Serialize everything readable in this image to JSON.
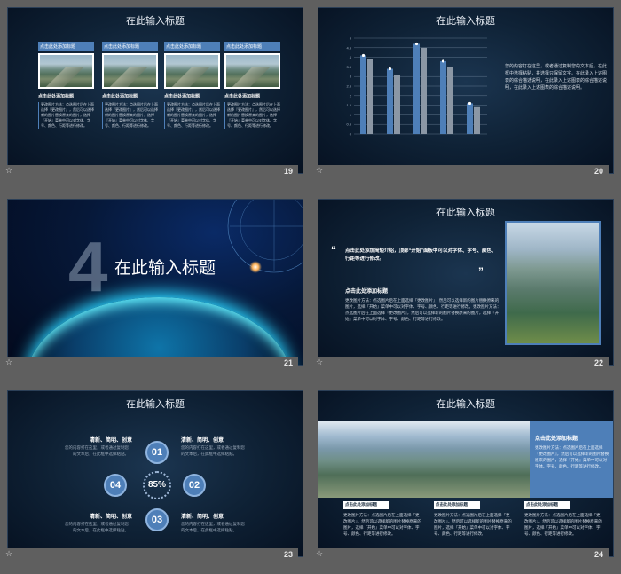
{
  "slides": [
    {
      "num": "19",
      "title": "在此输入标题",
      "cards": [
        {
          "head": "点击此处添加标题",
          "sub": "点击此处添加标题",
          "body": "更改图片方法：点选图片后在上面选择『更改图片』，然后可以选择新的图片替换原来的图片，选择『开始』菜单中可以对字体、字号、颜色、行距等进行修改。"
        },
        {
          "head": "点击此处添加标题",
          "sub": "点击此处添加标题",
          "body": "更改图片方法：点选图片后在上面选择『更改图片』，然后可以选择新的图片替换原来的图片，选择『开始』菜单中可以对字体、字号、颜色、行距等进行修改。"
        },
        {
          "head": "点击此处添加标题",
          "sub": "点击此处添加标题",
          "body": "更改图片方法：点选图片后在上面选择『更改图片』，然后可以选择新的图片替换原来的图片，选择『开始』菜单中可以对字体、字号、颜色、行距等进行修改。"
        },
        {
          "head": "点击此处添加标题",
          "sub": "点击此处添加标题",
          "body": "更改图片方法：点选图片后在上面选择『更改图片』，然后可以选择新的图片替换原来的图片，选择『开始』菜单中可以对字体、字号、颜色、行距等进行修改。"
        }
      ]
    },
    {
      "num": "20",
      "title": "在此输入标题",
      "text": "您的内容打在这里，或者通过复制您的文本后，在此框中选择粘贴，并选择只保留文字。在此录入上述图表的综合描述说明，在此录入上述图表的综合描述说明，在此录入上述图表的综合描述说明。"
    },
    {
      "num": "21",
      "big": "4",
      "title": "在此输入标题"
    },
    {
      "num": "22",
      "title": "在此输入标题",
      "quote_open": "“",
      "quote_close": "”",
      "quote": "点击此处添加简短介绍，顶部“开始”面板中可以对字体、字号、颜色、行距等进行修改。",
      "sub": "点击此处添加标题",
      "body": "更改图片方法：点选图片后在上面选择『更改图片』，然后可以选择新的图片替换原来的图片，选择『开始』菜单中可以对字体、字号、颜色、行距等进行修改。更改图片方法：点选图片后在上面选择『更改图片』，然后可以选择新的图片替换原来的图片，选择『开始』菜单中可以对字体、字号、颜色、行距等进行修改。"
    },
    {
      "num": "23",
      "title": "在此输入标题",
      "center": "85%",
      "petals": [
        "01",
        "02",
        "03",
        "04"
      ],
      "heads": [
        "清新、简明、创意",
        "清新、简明、创意",
        "清新、简明、创意",
        "清新、简明、创意"
      ],
      "body": "您的内容打在这里，或者通过复制您的文本后，在此框中选择粘贴。"
    },
    {
      "num": "24",
      "title": "在此输入标题",
      "box_head": "点击此处添加标题",
      "box_body": "更改图片方法：点选图片后在上面选择『更改图片』，然后可以选择新的图片替换原来的图片，选择『开始』菜单中可以对字体、字号、颜色、行距等进行修改。",
      "tags": [
        "点击此处添加标题",
        "点击此处添加标题",
        "点击此处添加标题"
      ],
      "body": "更改图片方法：点选图片后在上面选择『更改图片』，然后可以选择新的图片替换原来的图片，选择『开始』菜单中可以对字体、字号、颜色、行距等进行修改。"
    }
  ],
  "chart_data": {
    "type": "bar",
    "categories": [
      "",
      "",
      "",
      "",
      ""
    ],
    "series": [
      {
        "values": [
          4.1,
          3.4,
          4.7,
          3.8,
          1.6
        ]
      },
      {
        "values": [
          3.9,
          3.1,
          4.5,
          3.5,
          1.4
        ]
      }
    ],
    "y_ticks": [
      "5",
      "4.5",
      "4",
      "3.5",
      "3",
      "2.5",
      "2",
      "1.5",
      "1",
      "0.5",
      "0"
    ],
    "ylim": [
      0,
      5
    ],
    "colors": [
      "#4e7fb8",
      "#8b97a5"
    ]
  },
  "icons": {
    "star": "☆"
  }
}
